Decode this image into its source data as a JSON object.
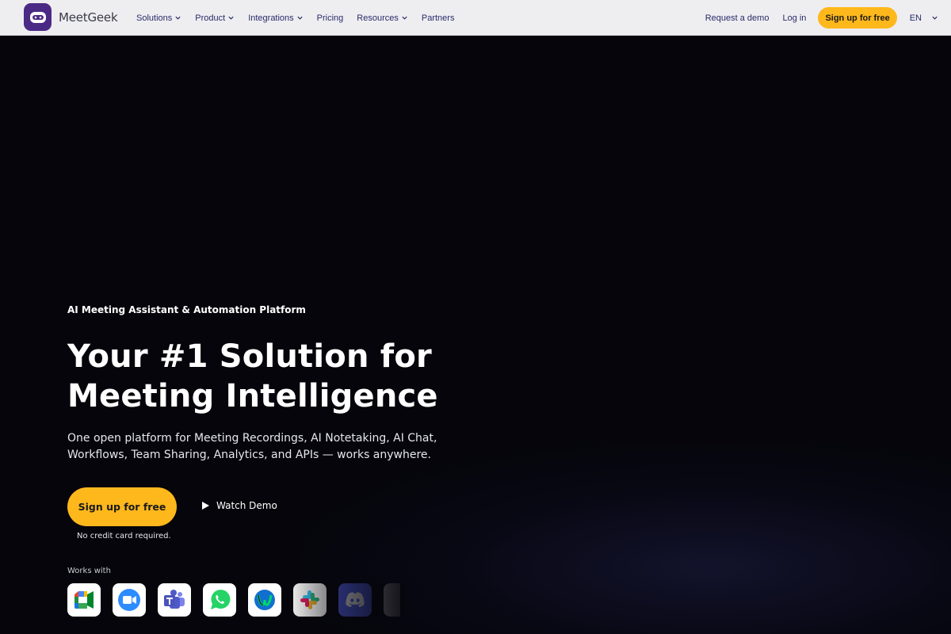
{
  "header": {
    "brand": "MeetGeek",
    "nav": [
      {
        "label": "Solutions",
        "has_dropdown": true
      },
      {
        "label": "Product",
        "has_dropdown": true
      },
      {
        "label": "Integrations",
        "has_dropdown": true
      },
      {
        "label": "Pricing",
        "has_dropdown": false
      },
      {
        "label": "Resources",
        "has_dropdown": true
      },
      {
        "label": "Partners",
        "has_dropdown": false
      }
    ],
    "request_demo": "Request a demo",
    "login": "Log in",
    "signup": "Sign up for free",
    "language": "EN"
  },
  "hero": {
    "eyebrow": "AI Meeting Assistant & Automation Platform",
    "headline_line1": "Your #1 Solution for",
    "headline_line2": "Meeting Intelligence",
    "subtext": "One open platform for Meeting Recordings, AI Notetaking, AI Chat, Workflows, Team Sharing, Analytics, and APIs — works anywhere.",
    "cta": "Sign up for free",
    "watch_demo": "Watch Demo",
    "cta_note": "No credit card required.",
    "works_with_label": "Works with",
    "integrations": [
      {
        "icon": "google-meet-icon"
      },
      {
        "icon": "zoom-icon"
      },
      {
        "icon": "microsoft-teams-icon"
      },
      {
        "icon": "whatsapp-icon"
      },
      {
        "icon": "webex-icon"
      },
      {
        "icon": "slack-icon"
      },
      {
        "icon": "discord-icon"
      },
      {
        "icon": "more-integration-icon"
      }
    ]
  },
  "colors": {
    "accent": "#ffb81c",
    "background": "#05050b",
    "brand_purple": "#4b2a86",
    "nav_text": "#2a2a6a"
  }
}
